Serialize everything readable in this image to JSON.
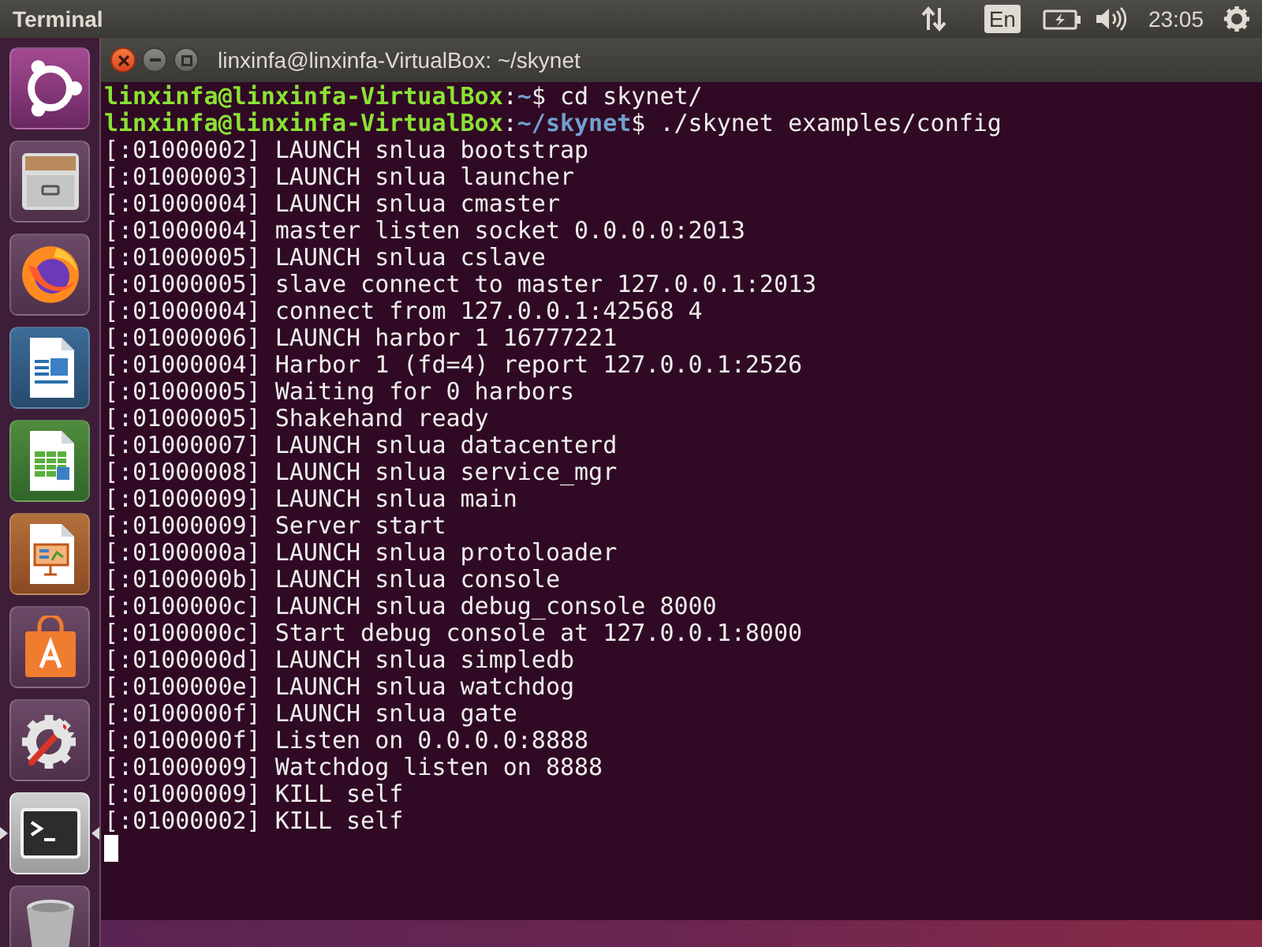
{
  "top_panel": {
    "app_name": "Terminal",
    "keyboard_layout": "En",
    "clock": "23:05"
  },
  "launcher": {
    "items": [
      {
        "kind": "dash",
        "running": false,
        "focused": false
      },
      {
        "kind": "files",
        "running": false,
        "focused": false
      },
      {
        "kind": "browser",
        "running": false,
        "focused": false
      },
      {
        "kind": "writer",
        "running": false,
        "focused": false
      },
      {
        "kind": "calc",
        "running": false,
        "focused": false
      },
      {
        "kind": "impress",
        "running": false,
        "focused": false
      },
      {
        "kind": "store",
        "running": false,
        "focused": false
      },
      {
        "kind": "settings",
        "running": false,
        "focused": false
      },
      {
        "kind": "terminal",
        "running": true,
        "focused": true
      },
      {
        "kind": "trash",
        "running": false,
        "focused": false
      }
    ]
  },
  "window": {
    "title": "linxinfa@linxinfa-VirtualBox: ~/skynet"
  },
  "terminal": {
    "lines": [
      {
        "kind": "prompt",
        "user_host": "linxinfa@linxinfa-VirtualBox",
        "colon": ":",
        "path": "~",
        "dollar": "$",
        "command": "cd skynet/"
      },
      {
        "kind": "prompt",
        "user_host": "linxinfa@linxinfa-VirtualBox",
        "colon": ":",
        "path": "~/skynet",
        "dollar": "$",
        "command": "./skynet examples/config"
      },
      {
        "kind": "output",
        "text": "[:01000002] LAUNCH snlua bootstrap"
      },
      {
        "kind": "output",
        "text": "[:01000003] LAUNCH snlua launcher"
      },
      {
        "kind": "output",
        "text": "[:01000004] LAUNCH snlua cmaster"
      },
      {
        "kind": "output",
        "text": "[:01000004] master listen socket 0.0.0.0:2013"
      },
      {
        "kind": "output",
        "text": "[:01000005] LAUNCH snlua cslave"
      },
      {
        "kind": "output",
        "text": "[:01000005] slave connect to master 127.0.0.1:2013"
      },
      {
        "kind": "output",
        "text": "[:01000004] connect from 127.0.0.1:42568 4"
      },
      {
        "kind": "output",
        "text": "[:01000006] LAUNCH harbor 1 16777221"
      },
      {
        "kind": "output",
        "text": "[:01000004] Harbor 1 (fd=4) report 127.0.0.1:2526"
      },
      {
        "kind": "output",
        "text": "[:01000005] Waiting for 0 harbors"
      },
      {
        "kind": "output",
        "text": "[:01000005] Shakehand ready"
      },
      {
        "kind": "output",
        "text": "[:01000007] LAUNCH snlua datacenterd"
      },
      {
        "kind": "output",
        "text": "[:01000008] LAUNCH snlua service_mgr"
      },
      {
        "kind": "output",
        "text": "[:01000009] LAUNCH snlua main"
      },
      {
        "kind": "output",
        "text": "[:01000009] Server start"
      },
      {
        "kind": "output",
        "text": "[:0100000a] LAUNCH snlua protoloader"
      },
      {
        "kind": "output",
        "text": "[:0100000b] LAUNCH snlua console"
      },
      {
        "kind": "output",
        "text": "[:0100000c] LAUNCH snlua debug_console 8000"
      },
      {
        "kind": "output",
        "text": "[:0100000c] Start debug console at 127.0.0.1:8000"
      },
      {
        "kind": "output",
        "text": "[:0100000d] LAUNCH snlua simpledb"
      },
      {
        "kind": "output",
        "text": "[:0100000e] LAUNCH snlua watchdog"
      },
      {
        "kind": "output",
        "text": "[:0100000f] LAUNCH snlua gate"
      },
      {
        "kind": "output",
        "text": "[:0100000f] Listen on 0.0.0.0:8888"
      },
      {
        "kind": "output",
        "text": "[:01000009] Watchdog listen on 8888"
      },
      {
        "kind": "output",
        "text": "[:01000009] KILL self"
      },
      {
        "kind": "output",
        "text": "[:01000002] KILL self"
      }
    ],
    "cursor_visible": true
  }
}
